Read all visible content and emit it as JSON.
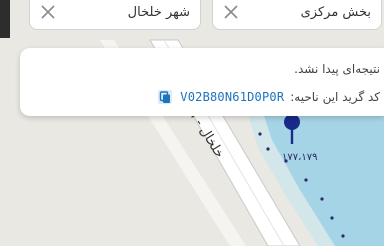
{
  "filters": {
    "district": {
      "label": "بخش مرکزی",
      "clear_icon": "close-icon"
    },
    "city": {
      "label": "شهر خلخال",
      "clear_icon": "close-icon"
    }
  },
  "result_card": {
    "message": "نتیجه‌ای پیدا نشد.",
    "area_code_label": "کد گرید این ناحیه:",
    "area_code": "V02B80N61D0P0R",
    "copy_icon": "copy-icon"
  },
  "map": {
    "road_label": "خلخال - ا",
    "coordinate_label": "۱۷۷،۱۷۹",
    "colors": {
      "land": "#eae8e3",
      "water": "#a5d4e6",
      "road": "#ffffff",
      "pin": "#1a2a8a"
    }
  }
}
